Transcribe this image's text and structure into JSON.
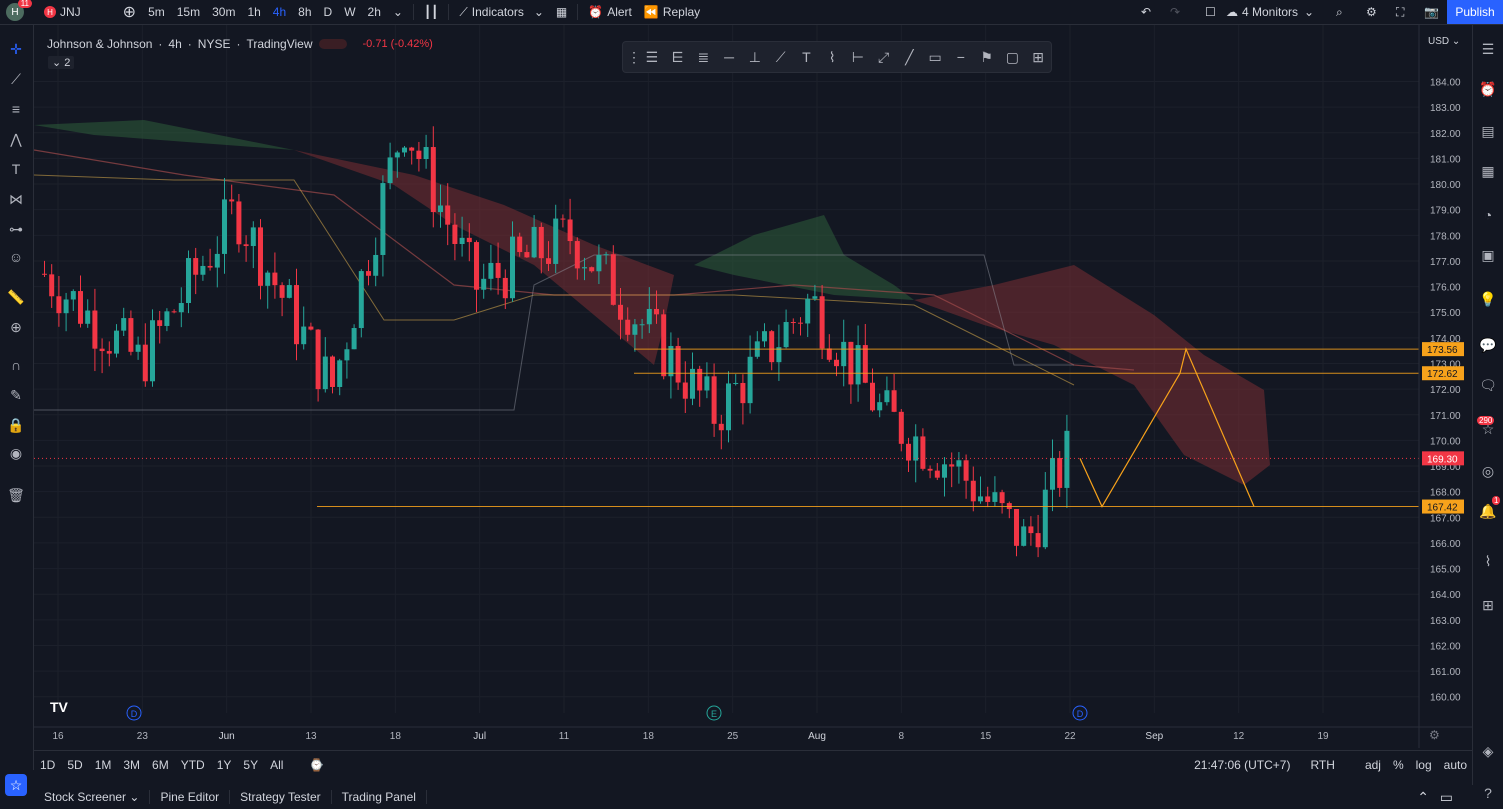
{
  "topbar": {
    "avatar_badge": "11",
    "symbol": "JNJ",
    "intervals": [
      "5m",
      "15m",
      "30m",
      "1h",
      "4h",
      "8h",
      "D",
      "W",
      "2h"
    ],
    "active_interval": "4h",
    "indicators_label": "Indicators",
    "alert_label": "Alert",
    "replay_label": "Replay",
    "layout_label": "4 Monitors",
    "publish_label": "Publish"
  },
  "legend": {
    "symbol_name": "Johnson & Johnson",
    "interval": "4h",
    "exchange": "NYSE",
    "source": "TradingView",
    "change": "-0.71 (-0.42%)",
    "indicator_count": "2"
  },
  "chart_data": {
    "type": "candlestick",
    "currency": "USD",
    "y_ticks": [
      "184.00",
      "183.00",
      "182.00",
      "181.00",
      "180.00",
      "179.00",
      "178.00",
      "177.00",
      "176.00",
      "175.00",
      "174.00",
      "173.00",
      "172.00",
      "171.00",
      "170.00",
      "169.00",
      "168.00",
      "167.00",
      "166.00",
      "165.00",
      "164.00",
      "163.00",
      "162.00",
      "161.00",
      "160.00"
    ],
    "ylim": [
      159.6,
      184.8
    ],
    "x_ticks": [
      {
        "label": "16",
        "bold": false
      },
      {
        "label": "23",
        "bold": false
      },
      {
        "label": "Jun",
        "bold": true
      },
      {
        "label": "13",
        "bold": false
      },
      {
        "label": "18",
        "bold": false
      },
      {
        "label": "Jul",
        "bold": true
      },
      {
        "label": "11",
        "bold": false
      },
      {
        "label": "18",
        "bold": false
      },
      {
        "label": "25",
        "bold": false
      },
      {
        "label": "Aug",
        "bold": true
      },
      {
        "label": "8",
        "bold": false
      },
      {
        "label": "15",
        "bold": false
      },
      {
        "label": "22",
        "bold": false
      },
      {
        "label": "Sep",
        "bold": true
      },
      {
        "label": "12",
        "bold": false
      },
      {
        "label": "19",
        "bold": false
      }
    ],
    "price_labels": [
      {
        "value": "173.56",
        "color": "#f7a21b"
      },
      {
        "value": "172.62",
        "color": "#f7a21b"
      },
      {
        "value": "169.30",
        "color": "#f23645"
      },
      {
        "value": "167.42",
        "color": "#f7a21b"
      }
    ],
    "current_price": 169.3,
    "horizontal_levels": [
      173.56,
      172.62,
      167.42
    ],
    "projection_path": [
      169.3,
      167.42,
      172.62,
      173.56,
      167.42
    ],
    "event_markers": [
      "D",
      "E",
      "D"
    ],
    "colors": {
      "up": "#26a69a",
      "down": "#f23645",
      "cloud_bull": "#2e5c3a",
      "cloud_bear": "#7a2e33",
      "level": "#f7a21b"
    }
  },
  "bottombar": {
    "ranges": [
      "1D",
      "5D",
      "1M",
      "3M",
      "6M",
      "YTD",
      "1Y",
      "5Y",
      "All"
    ],
    "time": "21:47:06 (UTC+7)",
    "session": "RTH",
    "adj": "adj",
    "percent": "%",
    "log": "log",
    "auto": "auto"
  },
  "panels": [
    "Stock Screener",
    "Pine Editor",
    "Strategy Tester",
    "Trading Panel"
  ],
  "right_badges": {
    "ideas": "290",
    "alerts": "1"
  }
}
